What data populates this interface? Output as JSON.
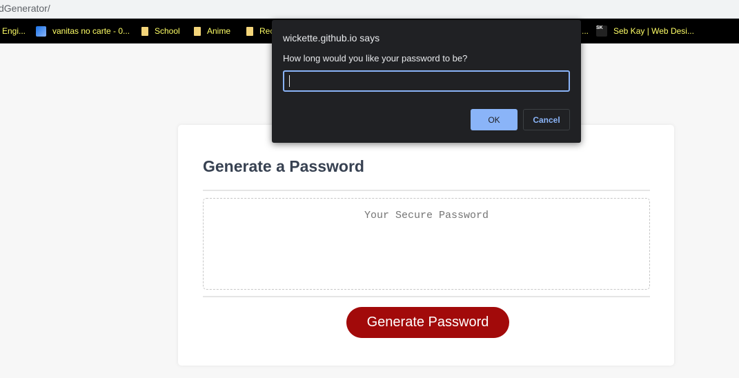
{
  "browser": {
    "address_text": "dGenerator/"
  },
  "bookmarks": [
    {
      "label": "Engi...",
      "icon": "none"
    },
    {
      "label": "vanitas no carte - 0...",
      "icon": "image-icon"
    },
    {
      "label": "School",
      "icon": "folder-icon"
    },
    {
      "label": "Anime",
      "icon": "folder-icon"
    },
    {
      "label": "Rec",
      "icon": "folder-icon"
    },
    {
      "label": "...",
      "icon": "none"
    },
    {
      "label": "Seb Kay | Web Desi...",
      "icon": "sk-icon",
      "icon_text": "SK"
    }
  ],
  "dialog": {
    "title": "wickette.github.io says",
    "message": "How long would you like your password to be?",
    "input_value": "",
    "ok_label": "OK",
    "cancel_label": "Cancel"
  },
  "card": {
    "title": "Generate a Password",
    "password_placeholder": "Your Secure Password",
    "generate_label": "Generate Password"
  },
  "colors": {
    "accent": "#8ab4f8",
    "button_red": "#a20a0a",
    "bookmark_text": "#ffff66"
  }
}
